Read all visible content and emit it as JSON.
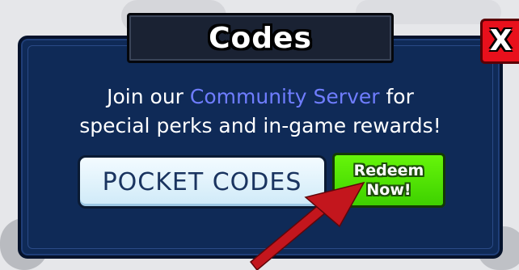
{
  "dialog": {
    "title": "Codes",
    "close_label": "X",
    "message_before": "Join our ",
    "message_link": "Community Server",
    "message_after_link": " for",
    "message_line2": "special perks and in-game rewards!",
    "pocket_codes_label": "POCKET CODES",
    "redeem_label": "Redeem\nNow!"
  },
  "annotation": {
    "arrow_color": "#c3161d"
  },
  "colors": {
    "panel": "#0f2a57",
    "link": "#6f7dff",
    "close": "#e8101c",
    "redeem": "#4fe004"
  }
}
